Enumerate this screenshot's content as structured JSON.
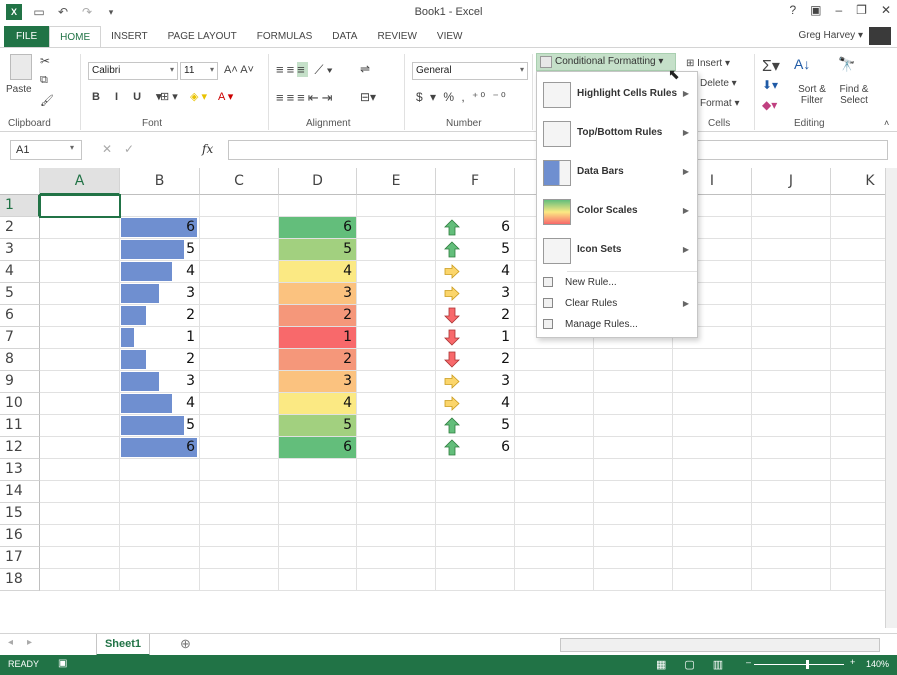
{
  "titlebar": {
    "title": "Book1 - Excel",
    "user": "Greg Harvey",
    "logo": "X"
  },
  "tabs": [
    "FILE",
    "HOME",
    "INSERT",
    "PAGE LAYOUT",
    "FORMULAS",
    "DATA",
    "REVIEW",
    "VIEW"
  ],
  "ribbon": {
    "font_name": "Calibri",
    "font_size": "11",
    "number_format": "General",
    "cf_label": "Conditional Formatting",
    "insert": "Insert",
    "delete": "Delete",
    "format": "Format",
    "sort_filter": "Sort & Filter",
    "find_select": "Find & Select",
    "paste": "Paste",
    "groups": {
      "clipboard": "Clipboard",
      "font": "Font",
      "alignment": "Alignment",
      "number": "Number",
      "cells": "Cells",
      "editing": "Editing"
    }
  },
  "formula_bar": {
    "name_box": "A1",
    "fx": "fx"
  },
  "columns": [
    "A",
    "B",
    "C",
    "D",
    "E",
    "F",
    "G",
    "H",
    "I",
    "J",
    "K"
  ],
  "rows": [
    "1",
    "2",
    "3",
    "4",
    "5",
    "6",
    "7",
    "8",
    "9",
    "10",
    "11",
    "12",
    "13",
    "14",
    "15",
    "16",
    "17",
    "18"
  ],
  "data": {
    "values": [
      6,
      5,
      4,
      3,
      2,
      1,
      2,
      3,
      4,
      5,
      6
    ],
    "b": [
      "6",
      "5",
      "4",
      "3",
      "2",
      "1",
      "2",
      "3",
      "4",
      "5",
      "6"
    ],
    "d": [
      "6",
      "5",
      "4",
      "3",
      "2",
      "1",
      "2",
      "3",
      "4",
      "5",
      "6"
    ],
    "f": [
      "6",
      "5",
      "4",
      "3",
      "2",
      "1",
      "2",
      "3",
      "4",
      "5",
      "6"
    ],
    "color_scale": [
      "#63be7b",
      "#a2d07f",
      "#fbe983",
      "#fbc27f",
      "#f5977a",
      "#f8696b",
      "#f5977a",
      "#fbc27f",
      "#fbe983",
      "#a2d07f",
      "#63be7b"
    ],
    "icons": [
      "up",
      "up",
      "right",
      "right",
      "down",
      "down",
      "down",
      "right",
      "right",
      "up",
      "up"
    ]
  },
  "menu": {
    "highlight": "Highlight Cells Rules",
    "topbottom": "Top/Bottom Rules",
    "databars": "Data Bars",
    "colorscales": "Color Scales",
    "iconsets": "Icon Sets",
    "newrule": "New Rule...",
    "clearrules": "Clear Rules",
    "managerules": "Manage Rules..."
  },
  "sheet": {
    "tab": "Sheet1"
  },
  "status": {
    "ready": "READY",
    "zoom": "140%"
  }
}
